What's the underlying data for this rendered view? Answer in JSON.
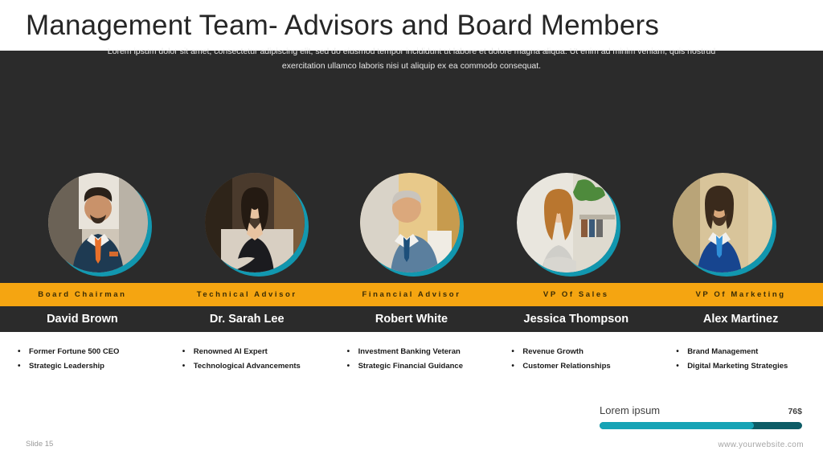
{
  "header": {
    "title": "Management Team- Advisors and Board Members"
  },
  "intro": {
    "text": "Lorem ipsum dolor sit amet, consectetur adipiscing elit, sed do eiusmod tempor incididunt ut labore et dolore magna aliqua. Ut enim ad minim veniam, quis nostrud exercitation ullamco laboris nisi ut aliquip ex ea commodo consequat."
  },
  "members": [
    {
      "role": "Board Chairman",
      "name": "David Brown",
      "avatar_name": "avatar-david-brown",
      "bullets": [
        "Former Fortune 500 CEO",
        "Strategic Leadership"
      ]
    },
    {
      "role": "Technical Advisor",
      "name": "Dr. Sarah Lee",
      "avatar_name": "avatar-sarah-lee",
      "bullets": [
        "Renowned AI Expert",
        "Technological Advancements"
      ]
    },
    {
      "role": "Financial Advisor",
      "name": "Robert White",
      "avatar_name": "avatar-robert-white",
      "bullets": [
        "Investment Banking Veteran",
        "Strategic Financial Guidance"
      ]
    },
    {
      "role": "VP Of Sales",
      "name": "Jessica Thompson",
      "avatar_name": "avatar-jessica-thompson",
      "bullets": [
        "Revenue Growth",
        "Customer Relationships"
      ]
    },
    {
      "role": "VP Of Marketing",
      "name": "Alex Martinez",
      "avatar_name": "avatar-alex-martinez",
      "bullets": [
        "Brand Management",
        "Digital Marketing Strategies"
      ]
    }
  ],
  "footer": {
    "slide_number": "Slide 15",
    "website": "www.yourwebsite.com",
    "progress": {
      "label": "Lorem ipsum",
      "value_text": "76$",
      "percent": 76
    }
  },
  "colors": {
    "accent_amber": "#f5a511",
    "accent_teal": "#16a3b5",
    "dark_bg": "#2b2b2b",
    "progress_track": "#0d5c66"
  }
}
